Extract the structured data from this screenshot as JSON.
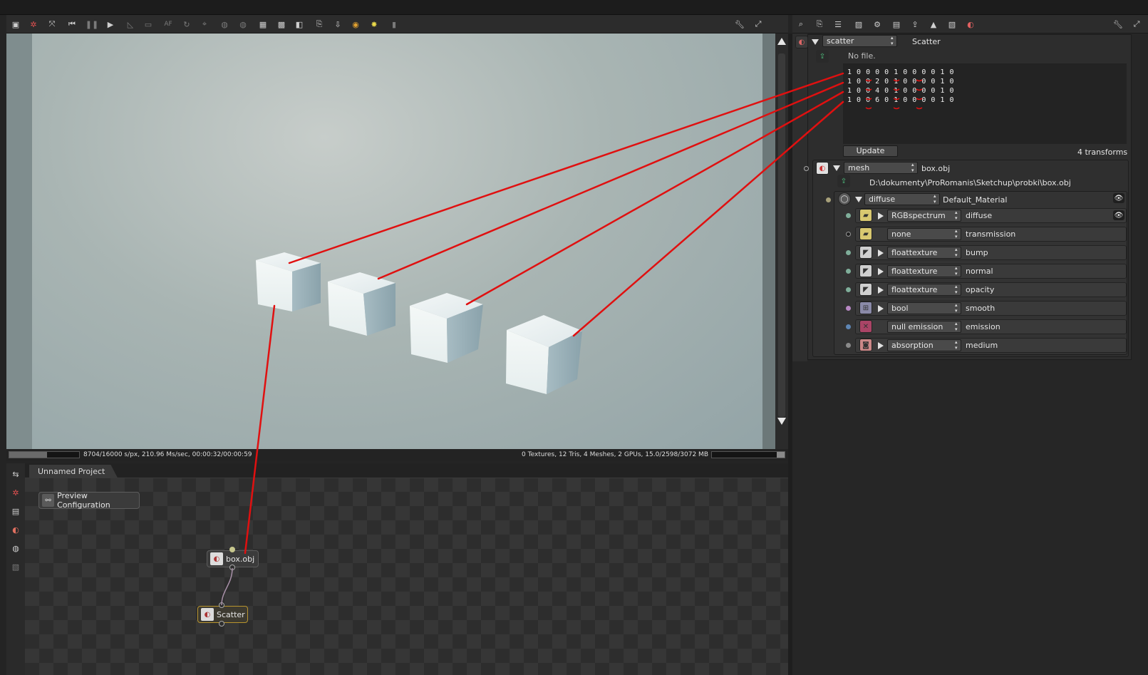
{
  "viewport": {
    "status_left": "8704/16000 s/px, 210.96 Ms/sec, 00:00:32/00:00:59",
    "status_right": "0 Textures, 12 Tris, 4 Meshes, 2 GPUs, 15.0/2598/3072 MB",
    "render_progress": 0.54,
    "gpu_memory_progress": 0.11
  },
  "toolbar_left": {
    "icons": [
      "camera-icon",
      "render-settings-icon",
      "fit-view-icon",
      "restart-render-icon",
      "pause-render-icon",
      "start-render-icon",
      "ruler-icon",
      "region-icon",
      "af-icon",
      "rotate-icon",
      "focus-picker-icon",
      "material-picker-icon",
      "object-picker-icon",
      "clay-mode-icon",
      "subsampling-icon",
      "checker-icon",
      "copy-to-clipboard-icon",
      "save-image-icon",
      "recenter-icon",
      "light-icon",
      "lock-icon"
    ],
    "af_label": "AF"
  },
  "toolbar_right": {
    "icons": [
      "node-inspector-icon",
      "copy-icon",
      "list-icon",
      "image-icon",
      "settings-icon",
      "layers-icon",
      "export-icon",
      "picture-icon",
      "texture-icon",
      "material-icon"
    ]
  },
  "inspector": {
    "scatter": {
      "type": "scatter",
      "name": "Scatter",
      "file_status": "No file.",
      "matrix_lines": [
        "1 0 0 0 0 1 0 0 0 0 1 0",
        "1 0 0 2 0 1 0 0 0 0 1 0",
        "1 0 0 4 0 1 0 0 0 0 1 0",
        "1 0 0 6 0 1 0 0 0 0 1 0"
      ],
      "update_label": "Update",
      "transforms_count": "4 transforms"
    },
    "mesh": {
      "type": "mesh",
      "name": "box.obj",
      "path": "D:\\dokumenty\\ProRomanis\\Sketchup\\probki\\box.obj"
    },
    "material": {
      "type": "diffuse",
      "name": "Default_Material"
    },
    "pins": [
      {
        "type": "RGBspectrum",
        "name": "diffuse",
        "expandable": true,
        "eye": true,
        "pin_color": "#7fae9a"
      },
      {
        "type": "none",
        "name": "transmission",
        "expandable": false,
        "eye": false,
        "pin_color": "#1e1e1e"
      },
      {
        "type": "floattexture",
        "name": "bump",
        "expandable": true,
        "eye": false,
        "pin_color": "#7fae9a"
      },
      {
        "type": "floattexture",
        "name": "normal",
        "expandable": true,
        "eye": false,
        "pin_color": "#7fae9a"
      },
      {
        "type": "floattexture",
        "name": "opacity",
        "expandable": true,
        "eye": false,
        "pin_color": "#7fae9a"
      },
      {
        "type": "bool",
        "name": "smooth",
        "expandable": true,
        "eye": false,
        "pin_color": "#b888c4"
      },
      {
        "type": "null emission",
        "name": "emission",
        "expandable": false,
        "eye": false,
        "pin_color": "#5e86b4"
      },
      {
        "type": "absorption",
        "name": "medium",
        "expandable": true,
        "eye": false,
        "pin_color": "#8a8a8a"
      }
    ]
  },
  "node_editor": {
    "project_tab": "Unnamed Project",
    "preview_button": "Preview Configuration",
    "nodes": {
      "mesh_node": "box.obj",
      "scatter_node": "Scatter"
    }
  },
  "annotation_color": "#e01010"
}
